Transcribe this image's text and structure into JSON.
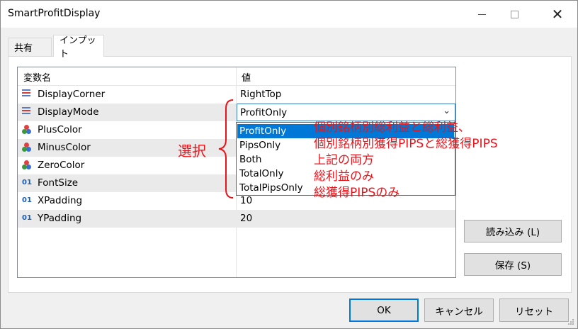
{
  "window": {
    "title": "SmartProfitDisplay",
    "controls": [
      "minimize-icon",
      "maximize-icon",
      "close-icon"
    ]
  },
  "tabs": [
    {
      "label": "共有"
    },
    {
      "label": "インプット",
      "active": true
    }
  ],
  "grid": {
    "columns": {
      "name": "変数名",
      "value": "値"
    },
    "rows": [
      {
        "icon": "enum-icon",
        "name": "DisplayCorner",
        "value": "RightTop"
      },
      {
        "icon": "enum-icon",
        "name": "DisplayMode",
        "value": "ProfitOnly"
      },
      {
        "icon": "color-icon",
        "name": "PlusColor",
        "value": ""
      },
      {
        "icon": "color-icon",
        "name": "MinusColor",
        "value": ""
      },
      {
        "icon": "color-icon",
        "name": "ZeroColor",
        "value": ""
      },
      {
        "icon": "integer-icon",
        "name": "FontSize",
        "value": ""
      },
      {
        "icon": "integer-icon",
        "name": "XPadding",
        "value": "10"
      },
      {
        "icon": "integer-icon",
        "name": "YPadding",
        "value": "20"
      }
    ]
  },
  "dropdown": {
    "current": "ProfitOnly",
    "options": [
      "ProfitOnly",
      "PipsOnly",
      "Both",
      "TotalOnly",
      "TotalPipsOnly"
    ],
    "selected_index": 0
  },
  "annotation": {
    "label": "選択",
    "lines": [
      "個別銘柄別総利益と総利益、",
      "個別銘柄別獲得PIPSと総獲得PIPS",
      "上記の両方",
      "総利益のみ",
      "総獲得PIPSのみ"
    ],
    "color": "#e8141b"
  },
  "buttons": {
    "load": "読み込み (L)",
    "save": "保存 (S)",
    "ok": "OK",
    "cancel": "キャンセル",
    "reset": "リセット"
  },
  "colors": {
    "accent": "#0078d7",
    "annotation": "#e8141b"
  }
}
